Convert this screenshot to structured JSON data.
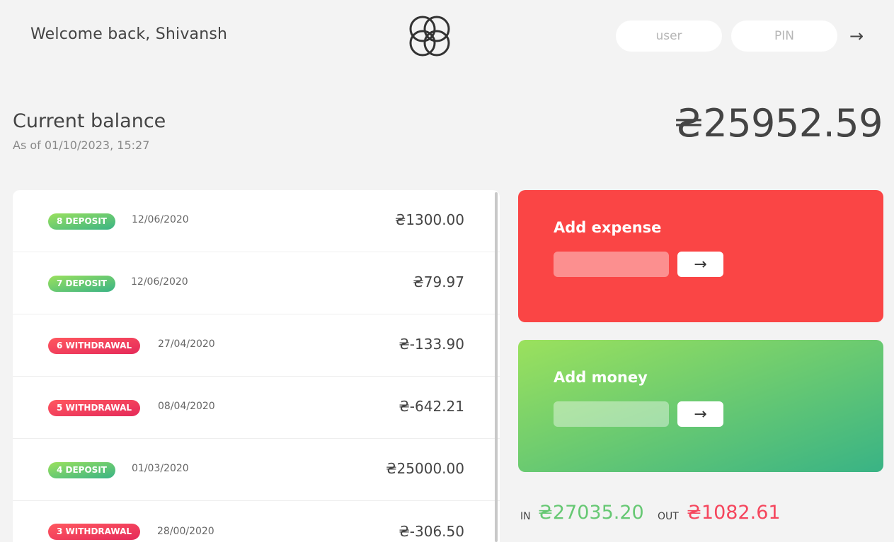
{
  "nav": {
    "welcome": "Welcome back, Shivansh",
    "login_user_placeholder": "user",
    "login_pin_placeholder": "PIN",
    "login_button": "→"
  },
  "balance": {
    "label": "Current balance",
    "date": "As of 01/10/2023, 15:27",
    "value": "₴25952.59"
  },
  "movements": [
    {
      "type": "8 DEPOSIT",
      "kind": "deposit",
      "date": "12/06/2020",
      "value": "₴1300.00"
    },
    {
      "type": "7 DEPOSIT",
      "kind": "deposit",
      "date": "12/06/2020",
      "value": "₴79.97"
    },
    {
      "type": "6 WITHDRAWAL",
      "kind": "withdrawal",
      "date": "27/04/2020",
      "value": "₴-133.90"
    },
    {
      "type": "5 WITHDRAWAL",
      "kind": "withdrawal",
      "date": "08/04/2020",
      "value": "₴-642.21"
    },
    {
      "type": "4 DEPOSIT",
      "kind": "deposit",
      "date": "01/03/2020",
      "value": "₴25000.00"
    },
    {
      "type": "3 WITHDRAWAL",
      "kind": "withdrawal",
      "date": "28/00/2020",
      "value": "₴-306.50"
    }
  ],
  "operations": {
    "expense": {
      "title": "Add expense",
      "button": "→"
    },
    "money": {
      "title": "Add money",
      "button": "→"
    }
  },
  "summary": {
    "in_label": "IN",
    "in_value": "₴27035.20",
    "out_label": "OUT",
    "out_value": "₴1082.61"
  },
  "colors": {
    "expense": "#fa4545",
    "money_from": "#9be15d",
    "money_to": "#39b385",
    "in": "#66c873",
    "out": "#f5465d"
  }
}
